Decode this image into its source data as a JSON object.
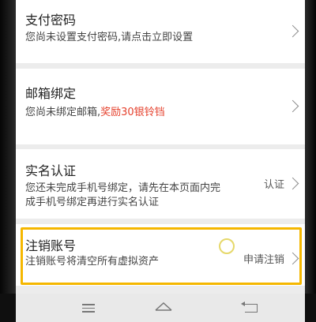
{
  "settings": {
    "payment_password": {
      "title": "支付密码",
      "subtitle": "您尚未设置支付密码,请点击立即设置"
    },
    "email_binding": {
      "title": "邮箱绑定",
      "subtitle_prefix": "您尚未绑定邮箱,",
      "reward": "奖励30银铃铛"
    },
    "real_name": {
      "title": "实名认证",
      "subtitle_line1": "您还未完成手机号绑定，请先在本页面内完",
      "subtitle_line2": "成手机号绑定再进行实名认证",
      "action": "认证"
    },
    "cancel_account": {
      "title": "注销账号",
      "subtitle": "注销账号将清空所有虚拟资产",
      "action": "申请注销"
    }
  },
  "colors": {
    "reward": "#e5412d",
    "highlight": "#f5b700",
    "background": "#ececec"
  },
  "icons": [
    "chevron-right-icon",
    "menu-icon",
    "home-icon",
    "back-icon"
  ]
}
